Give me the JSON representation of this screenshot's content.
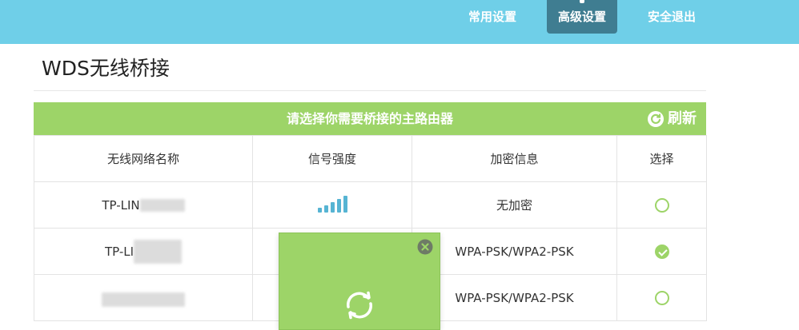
{
  "nav": {
    "items": [
      {
        "label": "常用设置",
        "active": false
      },
      {
        "label": "高级设置",
        "active": true
      },
      {
        "label": "安全退出",
        "active": false
      }
    ]
  },
  "page": {
    "title": "WDS无线桥接"
  },
  "panel": {
    "header": "请选择你需要桥接的主路由器",
    "refresh_label": "刷新",
    "columns": [
      "无线网络名称",
      "信号强度",
      "加密信息",
      "选择"
    ],
    "rows": [
      {
        "ssid": "TP-LIN",
        "signal_bars": 5,
        "encryption": "无加密",
        "selected": false
      },
      {
        "ssid": "TP-LI",
        "signal_bars": null,
        "encryption": "WPA-PSK/WPA2-PSK",
        "selected": true
      },
      {
        "ssid": "",
        "signal_bars": null,
        "encryption": "WPA-PSK/WPA2-PSK",
        "selected": false
      }
    ]
  },
  "colors": {
    "topbar": "#6fcfe8",
    "nav_active": "#3f7d91",
    "accent_green": "#9dd468",
    "signal_blue": "#56b4d3"
  },
  "icons": {
    "refresh": "refresh-icon",
    "close": "close-icon",
    "loading": "loading-spinner-icon"
  }
}
